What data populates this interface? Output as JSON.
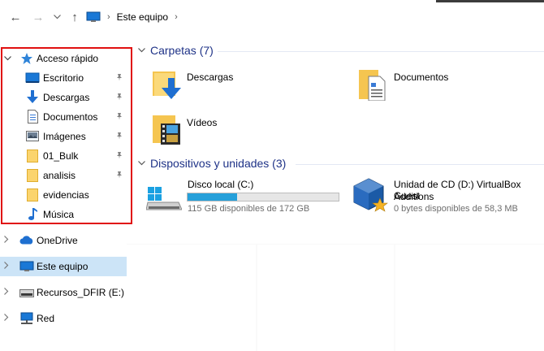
{
  "nav": {
    "back_icon": "←",
    "forward_icon": "→",
    "dropdown_icon": "⌄",
    "up_icon": "↑",
    "breadcrumb": "Este equipo"
  },
  "sidebar": {
    "quick_access": "Acceso rápido",
    "quick_items": [
      {
        "label": "Escritorio",
        "pinned": true
      },
      {
        "label": "Descargas",
        "pinned": true
      },
      {
        "label": "Documentos",
        "pinned": true
      },
      {
        "label": "Imágenes",
        "pinned": true
      },
      {
        "label": "01_Bulk",
        "pinned": true
      },
      {
        "label": "analisis",
        "pinned": true
      },
      {
        "label": "evidencias",
        "pinned": false
      },
      {
        "label": "Música",
        "pinned": false
      }
    ],
    "onedrive": "OneDrive",
    "este_equipo": "Este equipo",
    "recursos": "Recursos_DFIR (E:)",
    "red": "Red"
  },
  "main": {
    "folders_title": "Carpetas (7)",
    "folders": [
      {
        "label": "Descargas"
      },
      {
        "label": "Documentos"
      },
      {
        "label": "Vídeos"
      }
    ],
    "devices_title": "Dispositivos y unidades (3)",
    "disk": {
      "label": "Disco local (C:)",
      "sub": "115 GB disponibles de 172 GB",
      "used_fraction": 0.33
    },
    "cd": {
      "label_line1": "Unidad de CD (D:) VirtualBox Guest",
      "label_line2": "Additions",
      "sub": "0 bytes disponibles de 58,3 MB"
    }
  },
  "colors": {
    "accent": "#1e3287",
    "selection": "#cce4f7",
    "highlight_border": "#e01010",
    "progress": "#26a0da"
  }
}
